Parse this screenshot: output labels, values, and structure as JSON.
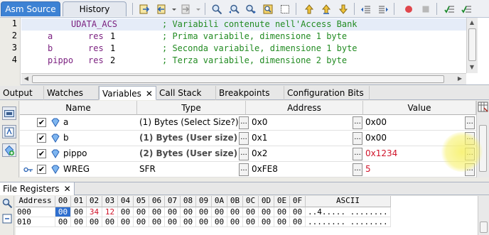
{
  "tabs": {
    "asm_source": "Asm Source",
    "history": "History"
  },
  "toolbar": {
    "icons": [
      "back-forward-icon",
      "go-back-icon",
      "go-forward-icon",
      "find-icon",
      "find-prev-icon",
      "find-next-icon",
      "find-selection-icon",
      "toggle-bookmark-icon",
      "prev-bookmark-icon",
      "next-bookmark-icon",
      "shift-left-icon",
      "shift-right-icon",
      "stop-macro-icon",
      "start-macro-icon",
      "comment-icon",
      "uncomment-icon"
    ]
  },
  "editor": {
    "lines": [
      {
        "num": "1",
        "label": "",
        "op": "UDATA_ACS",
        "arg": "",
        "comment": "; Variabili contenute nell'Access Bank"
      },
      {
        "num": "2",
        "label": "a",
        "op": "res",
        "arg": "1",
        "comment": "; Prima variabile, dimensione 1 byte"
      },
      {
        "num": "3",
        "label": "b",
        "op": "res",
        "arg": "1",
        "comment": "; Seconda variabile, dimensione 1 byte"
      },
      {
        "num": "4",
        "label": "pippo",
        "op": "res",
        "arg": "2",
        "comment": "; Terza variabile, dimensione 2 byte"
      }
    ]
  },
  "panel_tabs": [
    "Output",
    "Watches",
    "Variables",
    "Call Stack",
    "Breakpoints",
    "Configuration Bits"
  ],
  "active_panel_tab": "Variables",
  "variables": {
    "columns": {
      "name": "Name",
      "type": "Type",
      "address": "Address",
      "value": "Value"
    },
    "rows": [
      {
        "name": "a",
        "type": "(1) Bytes (Select Size?)",
        "address": "0x0",
        "value": "0x00",
        "value_changed": false,
        "checked": true
      },
      {
        "name": "b",
        "type": "(1) Bytes (User size)",
        "address": "0x1",
        "value": "0x00",
        "value_changed": false,
        "checked": true
      },
      {
        "name": "pippo",
        "type": "(2) Bytes (User size)",
        "address": "0x2",
        "value": "0x1234",
        "value_changed": true,
        "checked": true
      },
      {
        "name": "WREG",
        "type": "SFR",
        "address": "0xFE8",
        "value": "5",
        "value_changed": true,
        "checked": true
      }
    ]
  },
  "file_registers": {
    "tab_label": "File Registers",
    "address_header": "Address",
    "col_headers": [
      "00",
      "01",
      "02",
      "03",
      "04",
      "05",
      "06",
      "07",
      "08",
      "09",
      "0A",
      "0B",
      "0C",
      "0D",
      "0E",
      "0F"
    ],
    "ascii_header": "ASCII",
    "rows": [
      {
        "address": "000",
        "cells": [
          "00",
          "00",
          "34",
          "12",
          "00",
          "00",
          "00",
          "00",
          "00",
          "00",
          "00",
          "00",
          "00",
          "00",
          "00",
          "00"
        ],
        "ascii": "..4..... ........"
      },
      {
        "address": "010",
        "cells": [
          "00",
          "00",
          "00",
          "00",
          "00",
          "00",
          "00",
          "00",
          "00",
          "00",
          "00",
          "00",
          "00",
          "00",
          "00",
          "00"
        ],
        "ascii": "........ ........"
      }
    ]
  },
  "colors": {
    "accent": "#3d82d4",
    "changed_value": "#d0142a",
    "comment": "#228b22"
  }
}
